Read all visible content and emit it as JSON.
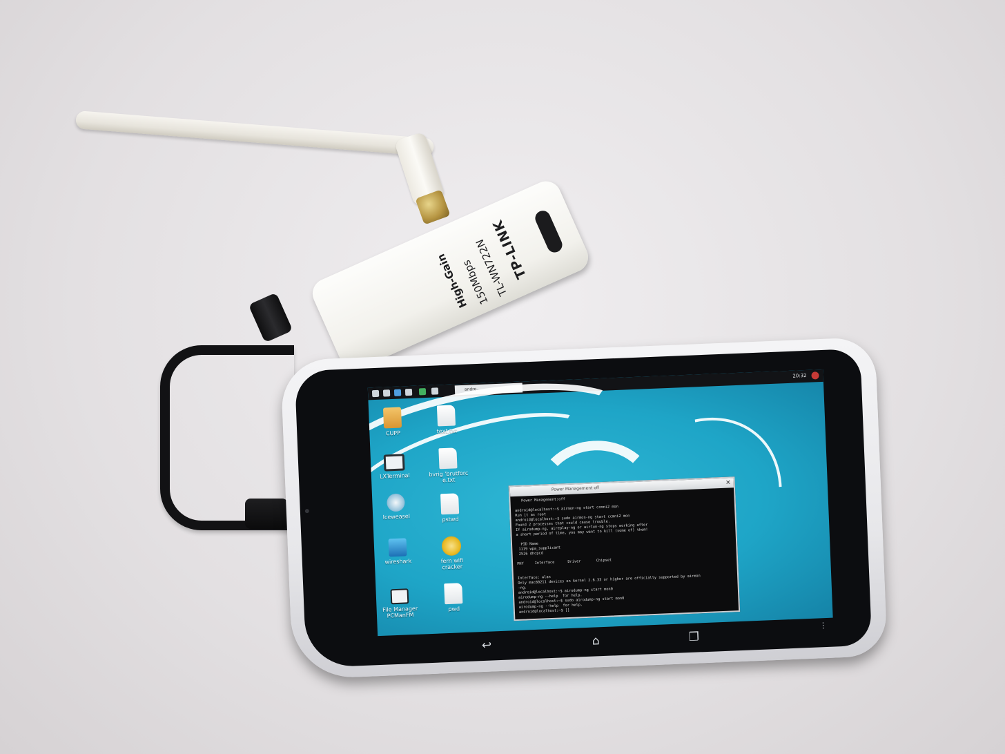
{
  "adapter": {
    "label_gain": "High-Gain",
    "label_speed": "150Mbps",
    "label_model": "TL-WN722N",
    "label_brand": "TP-LINK"
  },
  "tablet": {
    "taskbar_window": "andro...",
    "clock": "20:32",
    "desktop_icons": [
      {
        "label": "CUPP",
        "glyph": "folder"
      },
      {
        "label": "text.txt",
        "glyph": "file"
      },
      {
        "label": "LXTerminal",
        "glyph": "monitor"
      },
      {
        "label": "bvrig 'brutforc e.txt",
        "glyph": "file"
      },
      {
        "label": "Iceweasel",
        "glyph": "globe"
      },
      {
        "label": "pstwd",
        "glyph": "file"
      },
      {
        "label": "wireshark",
        "glyph": "shark"
      },
      {
        "label": "fern wifi cracker",
        "glyph": "wifi"
      },
      {
        "label": "File Manager PCManFM",
        "glyph": "fm"
      },
      {
        "label": "pwd",
        "glyph": "file"
      }
    ],
    "terminal": {
      "title": "Power Management off",
      "close_glyph": "✕",
      "body": "   Power Management:off\n\nandroid@localhost:~$ airmon-ng start ccmni2 mon\nRun it as root\nandroid@localhost:~$ sudo airmon-ng start ccmni2 mon\nFound 2 processes that could cause trouble.\nIf airodump-ng, aireplay-ng or airtun-ng stops working after\na short period of time, you may want to kill (some of) them!\n\n  PID Name\n 1119 wpa_supplicant\n 2526 dhcpcd\n\nPHY     Interface      Driver       Chipset\n\n\nInterface: wlan\nOnly mac80211 devices on kernel 2.6.33 or higher are officially supported by airmon\n-ng.\nandroid@localhost:~$ airodump-ng start mon0\nairodump-ng --help  for help.\nandroid@localhost:~$ sudo airodump-ng start mon0\nairodump-ng --help  for help.\nandroid@localhost:~$ []"
    },
    "nav": {
      "back_glyph": "↩",
      "home_glyph": "⌂",
      "recents_glyph": "❐",
      "overflow_glyph": "⋮"
    }
  }
}
